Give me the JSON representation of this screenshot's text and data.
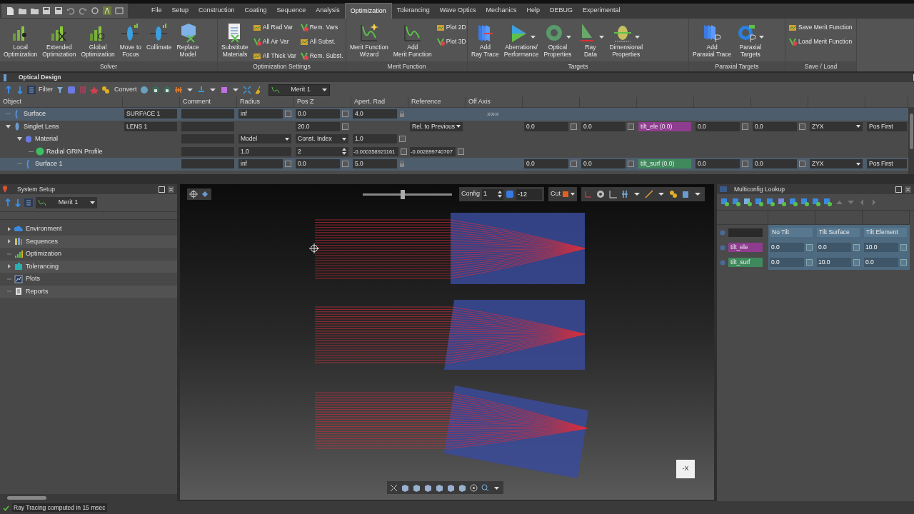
{
  "menu_tabs": [
    {
      "label": "File",
      "selected": false
    },
    {
      "label": "Setup",
      "selected": false
    },
    {
      "label": "Construction",
      "selected": false
    },
    {
      "label": "Coating",
      "selected": false
    },
    {
      "label": "Sequence",
      "selected": false
    },
    {
      "label": "Analysis",
      "selected": false
    },
    {
      "label": "Optimization",
      "selected": true
    },
    {
      "label": "Tolerancing",
      "selected": false
    },
    {
      "label": "Wave Optics",
      "selected": false
    },
    {
      "label": "Mechanics",
      "selected": false
    },
    {
      "label": "Help",
      "selected": false
    },
    {
      "label": "DEBUG",
      "selected": false
    },
    {
      "label": "Experimental",
      "selected": false
    }
  ],
  "ribbon": {
    "groups": [
      {
        "title": "Solver",
        "items": [
          {
            "kind": "large",
            "lines": [
              "Local",
              "Optimization"
            ],
            "dropdown": false
          },
          {
            "kind": "large",
            "lines": [
              "Extended",
              "Optimization"
            ],
            "dropdown": false
          },
          {
            "kind": "large",
            "lines": [
              "Global",
              "Optimization"
            ],
            "dropdown": false
          },
          {
            "kind": "large",
            "lines": [
              "Move to",
              "Focus"
            ],
            "dropdown": false
          },
          {
            "kind": "large",
            "lines": [
              "Collimate"
            ],
            "dropdown": false
          },
          {
            "kind": "large",
            "lines": [
              "Replace",
              "Model"
            ],
            "dropdown": false
          }
        ]
      },
      {
        "title": "Optimization Settings",
        "items": [
          {
            "kind": "large",
            "lines": [
              "Substitute",
              "Materials"
            ],
            "dropdown": false
          },
          {
            "kind": "small",
            "lines": [
              "All Rad Var"
            ]
          },
          {
            "kind": "small",
            "lines": [
              "All Air Var"
            ]
          },
          {
            "kind": "small",
            "lines": [
              "All Thick Var"
            ]
          },
          {
            "kind": "small",
            "lines": [
              "Rem. Vars"
            ]
          },
          {
            "kind": "small",
            "lines": [
              "All Subst."
            ]
          },
          {
            "kind": "small",
            "lines": [
              "Rem. Subst."
            ]
          }
        ]
      },
      {
        "title": "Merit Function",
        "items": [
          {
            "kind": "large",
            "lines": [
              "Merit Function",
              "Wizard"
            ],
            "dropdown": false
          },
          {
            "kind": "large",
            "lines": [
              "Add",
              "Merit Function"
            ],
            "dropdown": false
          },
          {
            "kind": "small",
            "lines": [
              "Plot 2D"
            ]
          },
          {
            "kind": "small",
            "lines": [
              "Plot 3D"
            ]
          }
        ]
      },
      {
        "title": "Targets",
        "items": [
          {
            "kind": "large",
            "lines": [
              "Add",
              "Ray Trace"
            ],
            "dropdown": false
          },
          {
            "kind": "large",
            "lines": [
              "Aberrations/",
              "Performance"
            ],
            "dropdown": true
          },
          {
            "kind": "large",
            "lines": [
              "Optical",
              "Properties"
            ],
            "dropdown": true
          },
          {
            "kind": "large",
            "lines": [
              "Ray",
              "Data"
            ],
            "dropdown": true
          },
          {
            "kind": "large",
            "lines": [
              "Dimensional",
              "Properties"
            ],
            "dropdown": true
          }
        ]
      },
      {
        "title": "Paraxial Targets",
        "items": [
          {
            "kind": "large",
            "lines": [
              "Add",
              "Paraxial Trace"
            ],
            "dropdown": false
          },
          {
            "kind": "large",
            "lines": [
              "Paraxial",
              "Targets"
            ],
            "dropdown": true
          }
        ]
      },
      {
        "title": "Save / Load",
        "items": [
          {
            "kind": "small",
            "lines": [
              "Save Merit Function"
            ]
          },
          {
            "kind": "small",
            "lines": [
              "Load Merit Function"
            ]
          }
        ]
      }
    ]
  },
  "optical_design": {
    "title": "Optical Design",
    "filter": "Filter",
    "convert": "Convert",
    "merit": "Merit 1",
    "columns": [
      "Object",
      "Comment",
      "Radius",
      "Pos Z",
      "Apert. Rad",
      "Reference",
      "Off Axis"
    ],
    "rows": [
      {
        "label": "Surface",
        "kind": "surface",
        "selected": true,
        "cells": [
          {
            "kind": "field",
            "value": "SURFACE 1"
          },
          {
            "kind": "field"
          },
          {
            "kind": "field",
            "value": "inf",
            "variable": false
          },
          {
            "kind": "field",
            "value": "0.0",
            "variable": false
          },
          {
            "kind": "field",
            "value": "4.0",
            "lock": true
          },
          null,
          {
            "kind": "text",
            "value": "»»»"
          }
        ]
      },
      {
        "label": "Singlet Lens",
        "kind": "lens",
        "selected": false,
        "expanded": true,
        "cells": [
          {
            "kind": "field",
            "value": "LENS 1"
          },
          {
            "kind": "field"
          },
          null,
          {
            "kind": "field",
            "value": "20.0",
            "variable": false
          },
          null,
          {
            "kind": "dropdown",
            "value": "Rel. to Previous"
          },
          null,
          {
            "kind": "field",
            "value": "0.0",
            "variable": false
          },
          {
            "kind": "field",
            "value": "0.0",
            "variable": false
          },
          {
            "kind": "tag",
            "value": "tilt_ele (0.0)",
            "color": "#8e3c8e"
          },
          {
            "kind": "field",
            "value": "0.0",
            "variable": false
          },
          {
            "kind": "field",
            "value": "0.0",
            "variable": false
          },
          {
            "kind": "dropdown",
            "value": "ZYX"
          },
          {
            "kind": "field",
            "value": "Pos First"
          }
        ],
        "children": [
          {
            "label": "Material",
            "kind": "material",
            "selected": false,
            "expanded": true,
            "cells": [
              null,
              {
                "kind": "field"
              },
              {
                "kind": "dropdown",
                "value": "Model"
              },
              {
                "kind": "dropdown",
                "value": "Const. Index"
              },
              {
                "kind": "field",
                "value": "1.0",
                "variable": false
              }
            ],
            "children": [
              {
                "label": "Radial GRIN Profile",
                "kind": "profile",
                "selected": false,
                "cells": [
                  null,
                  {
                    "kind": "field"
                  },
                  {
                    "kind": "field",
                    "value": "1.0"
                  },
                  {
                    "kind": "spin",
                    "value": "2"
                  },
                  {
                    "kind": "field",
                    "value": "-0.000358921161",
                    "variable": false
                  },
                  {
                    "kind": "field",
                    "value": "-0.002899740707",
                    "variable": false
                  }
                ]
              }
            ]
          },
          {
            "label": "Surface 1",
            "kind": "surface",
            "selected": true,
            "cells": [
              null,
              {
                "kind": "field"
              },
              {
                "kind": "field",
                "value": "inf",
                "variable": false
              },
              {
                "kind": "field",
                "value": "0.0",
                "variable": false
              },
              {
                "kind": "field",
                "value": "5.0",
                "lock": true
              },
              null,
              null,
              {
                "kind": "field",
                "value": "0.0",
                "variable": false
              },
              {
                "kind": "field",
                "value": "0.0",
                "variable": false
              },
              {
                "kind": "tag",
                "value": "tilt_surf (0.0)",
                "color": "#3f8a5c"
              },
              {
                "kind": "field",
                "value": "0.0",
                "variable": false
              },
              {
                "kind": "field",
                "value": "0.0",
                "variable": false
              },
              {
                "kind": "dropdown",
                "value": "ZYX"
              },
              {
                "kind": "field",
                "value": "Pos First"
              }
            ]
          }
        ]
      }
    ]
  },
  "system_setup": {
    "title": "System Setup",
    "merit": "Merit 1",
    "items": [
      {
        "label": "Environment",
        "expandable": true
      },
      {
        "label": "Sequences",
        "expandable": true
      },
      {
        "label": "Optimization",
        "expandable": false
      },
      {
        "label": "Tolerancing",
        "expandable": true
      },
      {
        "label": "Plots",
        "expandable": false
      },
      {
        "label": "Reports",
        "expandable": false
      }
    ]
  },
  "viewer": {
    "slider": {
      "level": 0.45
    },
    "config_label": "Config",
    "config": "1",
    "field": "-12",
    "cut": "Cut",
    "axis_label": "-X"
  },
  "multiconfig": {
    "title": "Multiconfig Lookup",
    "columns": [
      "No Tilt",
      "Tilt Surface",
      "Tilt Element"
    ],
    "rows": [
      {
        "name": "tilt_ele",
        "color": "#8e3c8e",
        "values": [
          {
            "value": "0.0",
            "variable": false
          },
          {
            "value": "0.0",
            "variable": false
          },
          {
            "value": "10.0",
            "variable": false
          }
        ]
      },
      {
        "name": "tilt_surf",
        "color": "#3f8a5c",
        "values": [
          {
            "value": "0.0",
            "variable": false
          },
          {
            "value": "10.0",
            "variable": false
          },
          {
            "value": "0.0",
            "variable": false
          }
        ]
      }
    ]
  },
  "status_bar": {
    "message": "Ray Tracing computed in 15 msec"
  }
}
